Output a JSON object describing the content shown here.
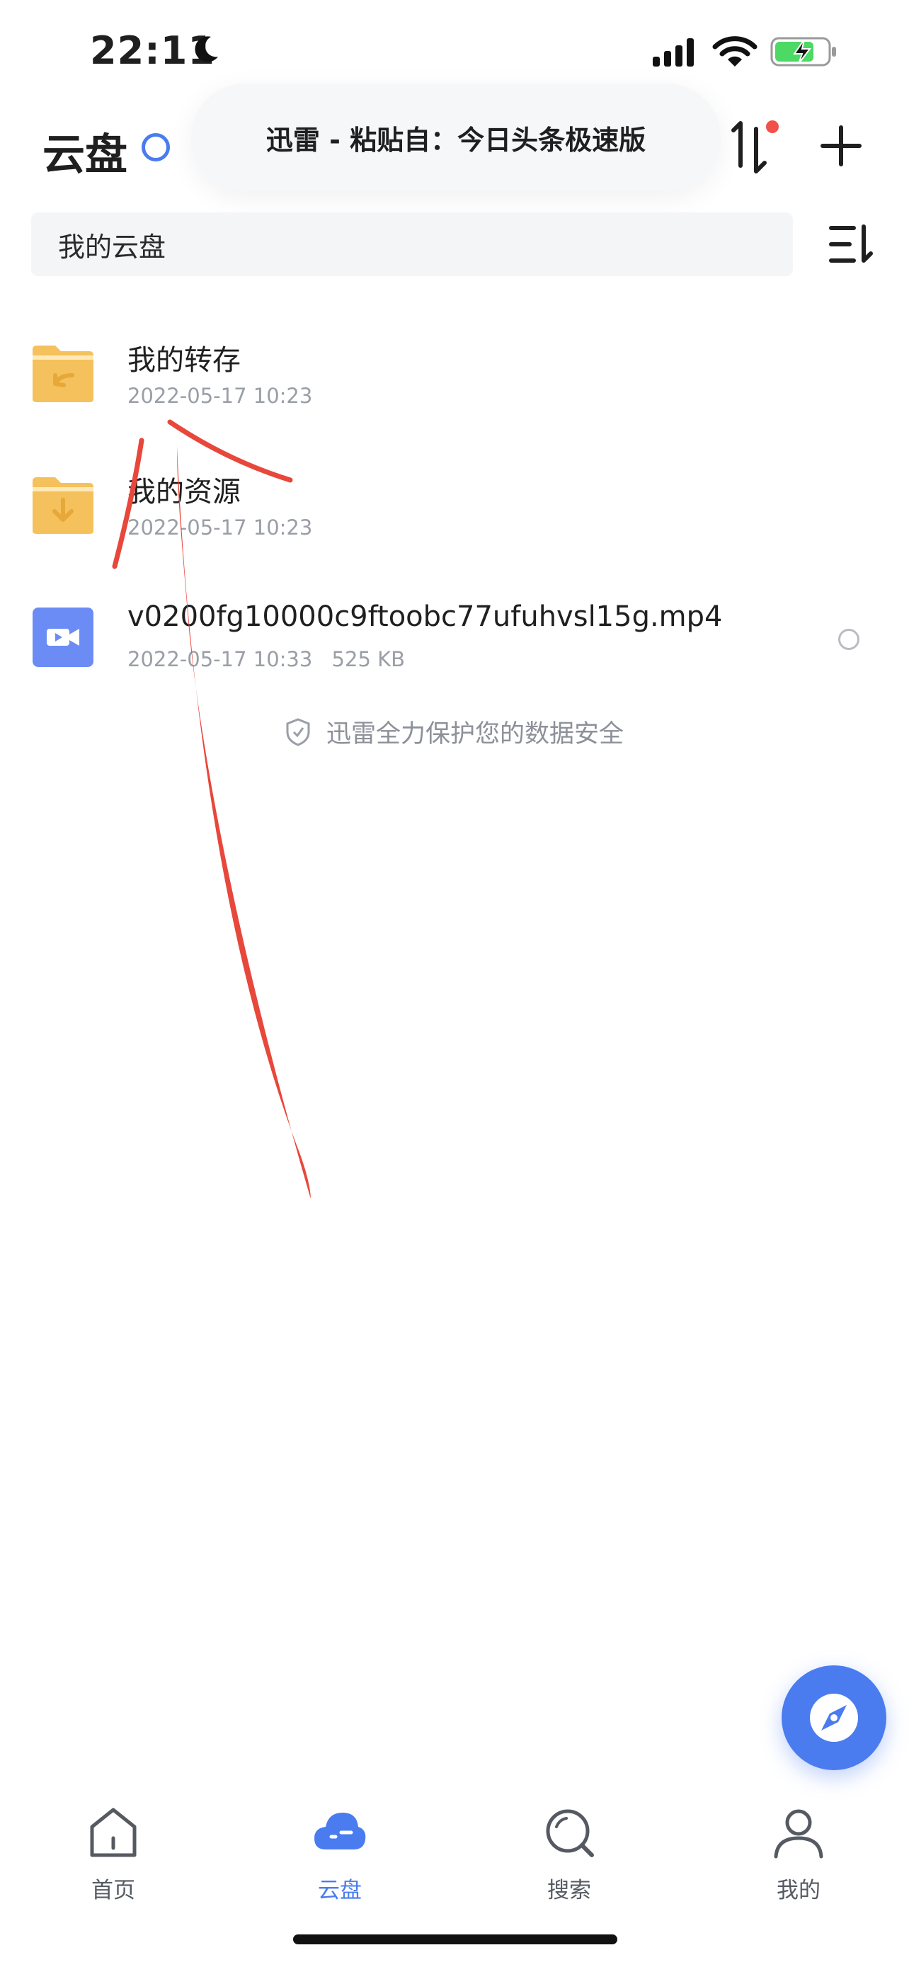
{
  "status_bar": {
    "time": "22:11",
    "icons": [
      "moon-icon",
      "signal-icon",
      "wifi-icon",
      "battery-charging-icon"
    ]
  },
  "header": {
    "title": "云盘",
    "paste_banner": "迅雷 - 粘贴自：今日头条极速版",
    "icons": [
      "sync-ring-icon",
      "transfer-icon",
      "add-icon"
    ]
  },
  "search": {
    "text": "我的云盘",
    "sort_icon": "sort-icon"
  },
  "files": [
    {
      "name": "我的转存",
      "date": "2022-05-17 10:23",
      "size": "",
      "icon": "folder-transfer-icon"
    },
    {
      "name": "我的资源",
      "date": "2022-05-17 10:23",
      "size": "",
      "icon": "folder-download-icon"
    },
    {
      "name": "v0200fg10000c9ftoobc77ufuhvsl15g.mp4",
      "date": "2022-05-17 10:33",
      "size": "525 KB",
      "icon": "video-file-icon"
    }
  ],
  "security_note": "迅雷全力保护您的数据安全",
  "tabs": [
    {
      "label": "首页",
      "icon": "home-icon",
      "active": false
    },
    {
      "label": "云盘",
      "icon": "cloud-icon",
      "active": true
    },
    {
      "label": "搜索",
      "icon": "search-icon",
      "active": false
    },
    {
      "label": "我的",
      "icon": "profile-icon",
      "active": false
    }
  ],
  "colors": {
    "accent": "#4a7cf0",
    "folder": "#f5c15c",
    "video": "#6b8cf5",
    "annotation": "#e8473b"
  }
}
